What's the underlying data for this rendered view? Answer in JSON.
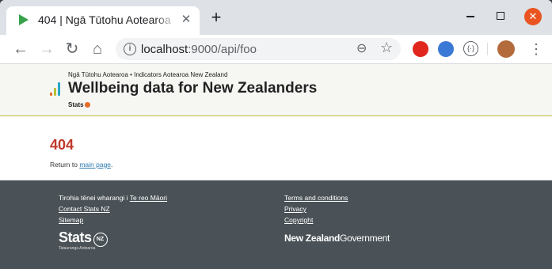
{
  "browser": {
    "tab_title": "404 | Ngā Tūtohu Aotearoa",
    "tab_close_glyph": "✕",
    "new_tab_glyph": "+",
    "close_glyph": "✕",
    "url_host": "localhost",
    "url_path": ":9000/api/foo",
    "back_glyph": "←",
    "forward_glyph": "→",
    "reload_glyph": "↻",
    "home_glyph": "⌂",
    "zoom_glyph": "⊖",
    "star_glyph": "☆",
    "menu_glyph": "⋮",
    "info_glyph": "i",
    "ext_code_glyph": "{·}"
  },
  "header": {
    "supertitle": "Ngā Tūtohu Aotearoa • Indicators Aotearoa New Zealand",
    "title": "Wellbeing data for New Zealanders",
    "stats_label": "Stats",
    "logo_colors": [
      "#e56c29",
      "#b6c234",
      "#2aa6c8"
    ]
  },
  "main": {
    "error_code": "404",
    "return_prefix": "Return to ",
    "return_link": "main page",
    "return_suffix": "."
  },
  "footer": {
    "lang_prefix": "Tirohia tēnei wharangi i ",
    "lang_link": "Te reo Māori",
    "contact": "Contact Stats NZ",
    "sitemap": "Sitemap",
    "terms": "Terms and conditions",
    "privacy": "Privacy",
    "copyright": "Copyright",
    "stats_logo": "Stats",
    "stats_logo_nz": "NZ",
    "stats_tagline": "Tatauranga Aotearoa",
    "nzgov_a": "New Zealand",
    "nzgov_b": "Government"
  }
}
